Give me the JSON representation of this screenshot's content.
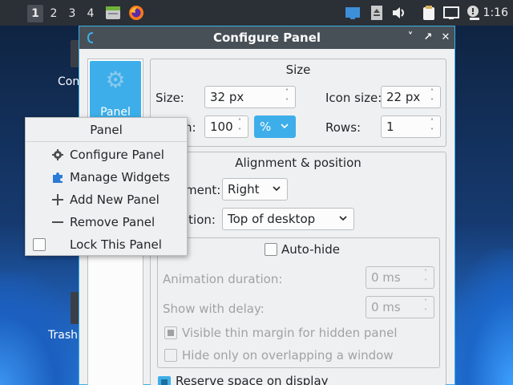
{
  "taskbar": {
    "desktops": [
      "1",
      "2",
      "3",
      "4"
    ],
    "active_desktop": "1",
    "clock": "1:16",
    "icons": [
      "file-manager-icon",
      "firefox-icon",
      "screen-icon",
      "storage-icon",
      "volume-icon",
      "clipboard-icon",
      "network-icon",
      "notification-icon"
    ]
  },
  "desktop": {
    "icon_labels": [
      "Con",
      "Trash"
    ]
  },
  "dialog": {
    "title": "Configure Panel",
    "sidebar": {
      "item_label": "Panel"
    },
    "size": {
      "title": "Size",
      "size_label": "Size:",
      "size_value": "32 px",
      "icon_size_label": "Icon size:",
      "icon_size_value": "22 px",
      "length_label": "h:",
      "length_value": "100",
      "length_unit": "%",
      "rows_label": "Rows:",
      "rows_value": "1"
    },
    "alignment": {
      "title": "Alignment & position",
      "alignment_label": "ment:",
      "alignment_value": "Right",
      "position_label": "ition:",
      "position_value": "Top of desktop"
    },
    "autohide": {
      "label": "Auto-hide",
      "animation_label": "Animation duration:",
      "animation_value": "0 ms",
      "delay_label": "Show with delay:",
      "delay_value": "0 ms",
      "thin_margin_label": "Visible thin margin for hidden panel",
      "overlap_label": "Hide only on overlapping a window"
    },
    "reserve_label": "Reserve space on display"
  },
  "context_menu": {
    "title": "Panel",
    "items": [
      {
        "label": "Configure Panel",
        "icon": "gear-icon"
      },
      {
        "label": "Manage Widgets",
        "icon": "puzzle-icon"
      },
      {
        "label": "Add New Panel",
        "icon": "plus-icon"
      },
      {
        "label": "Remove Panel",
        "icon": "minus-icon"
      },
      {
        "label": "Lock This Panel",
        "icon": "checkbox-icon"
      }
    ]
  },
  "colors": {
    "accent": "#3daee9",
    "titlebar": "#475057",
    "taskbar": "#2b2f36"
  }
}
